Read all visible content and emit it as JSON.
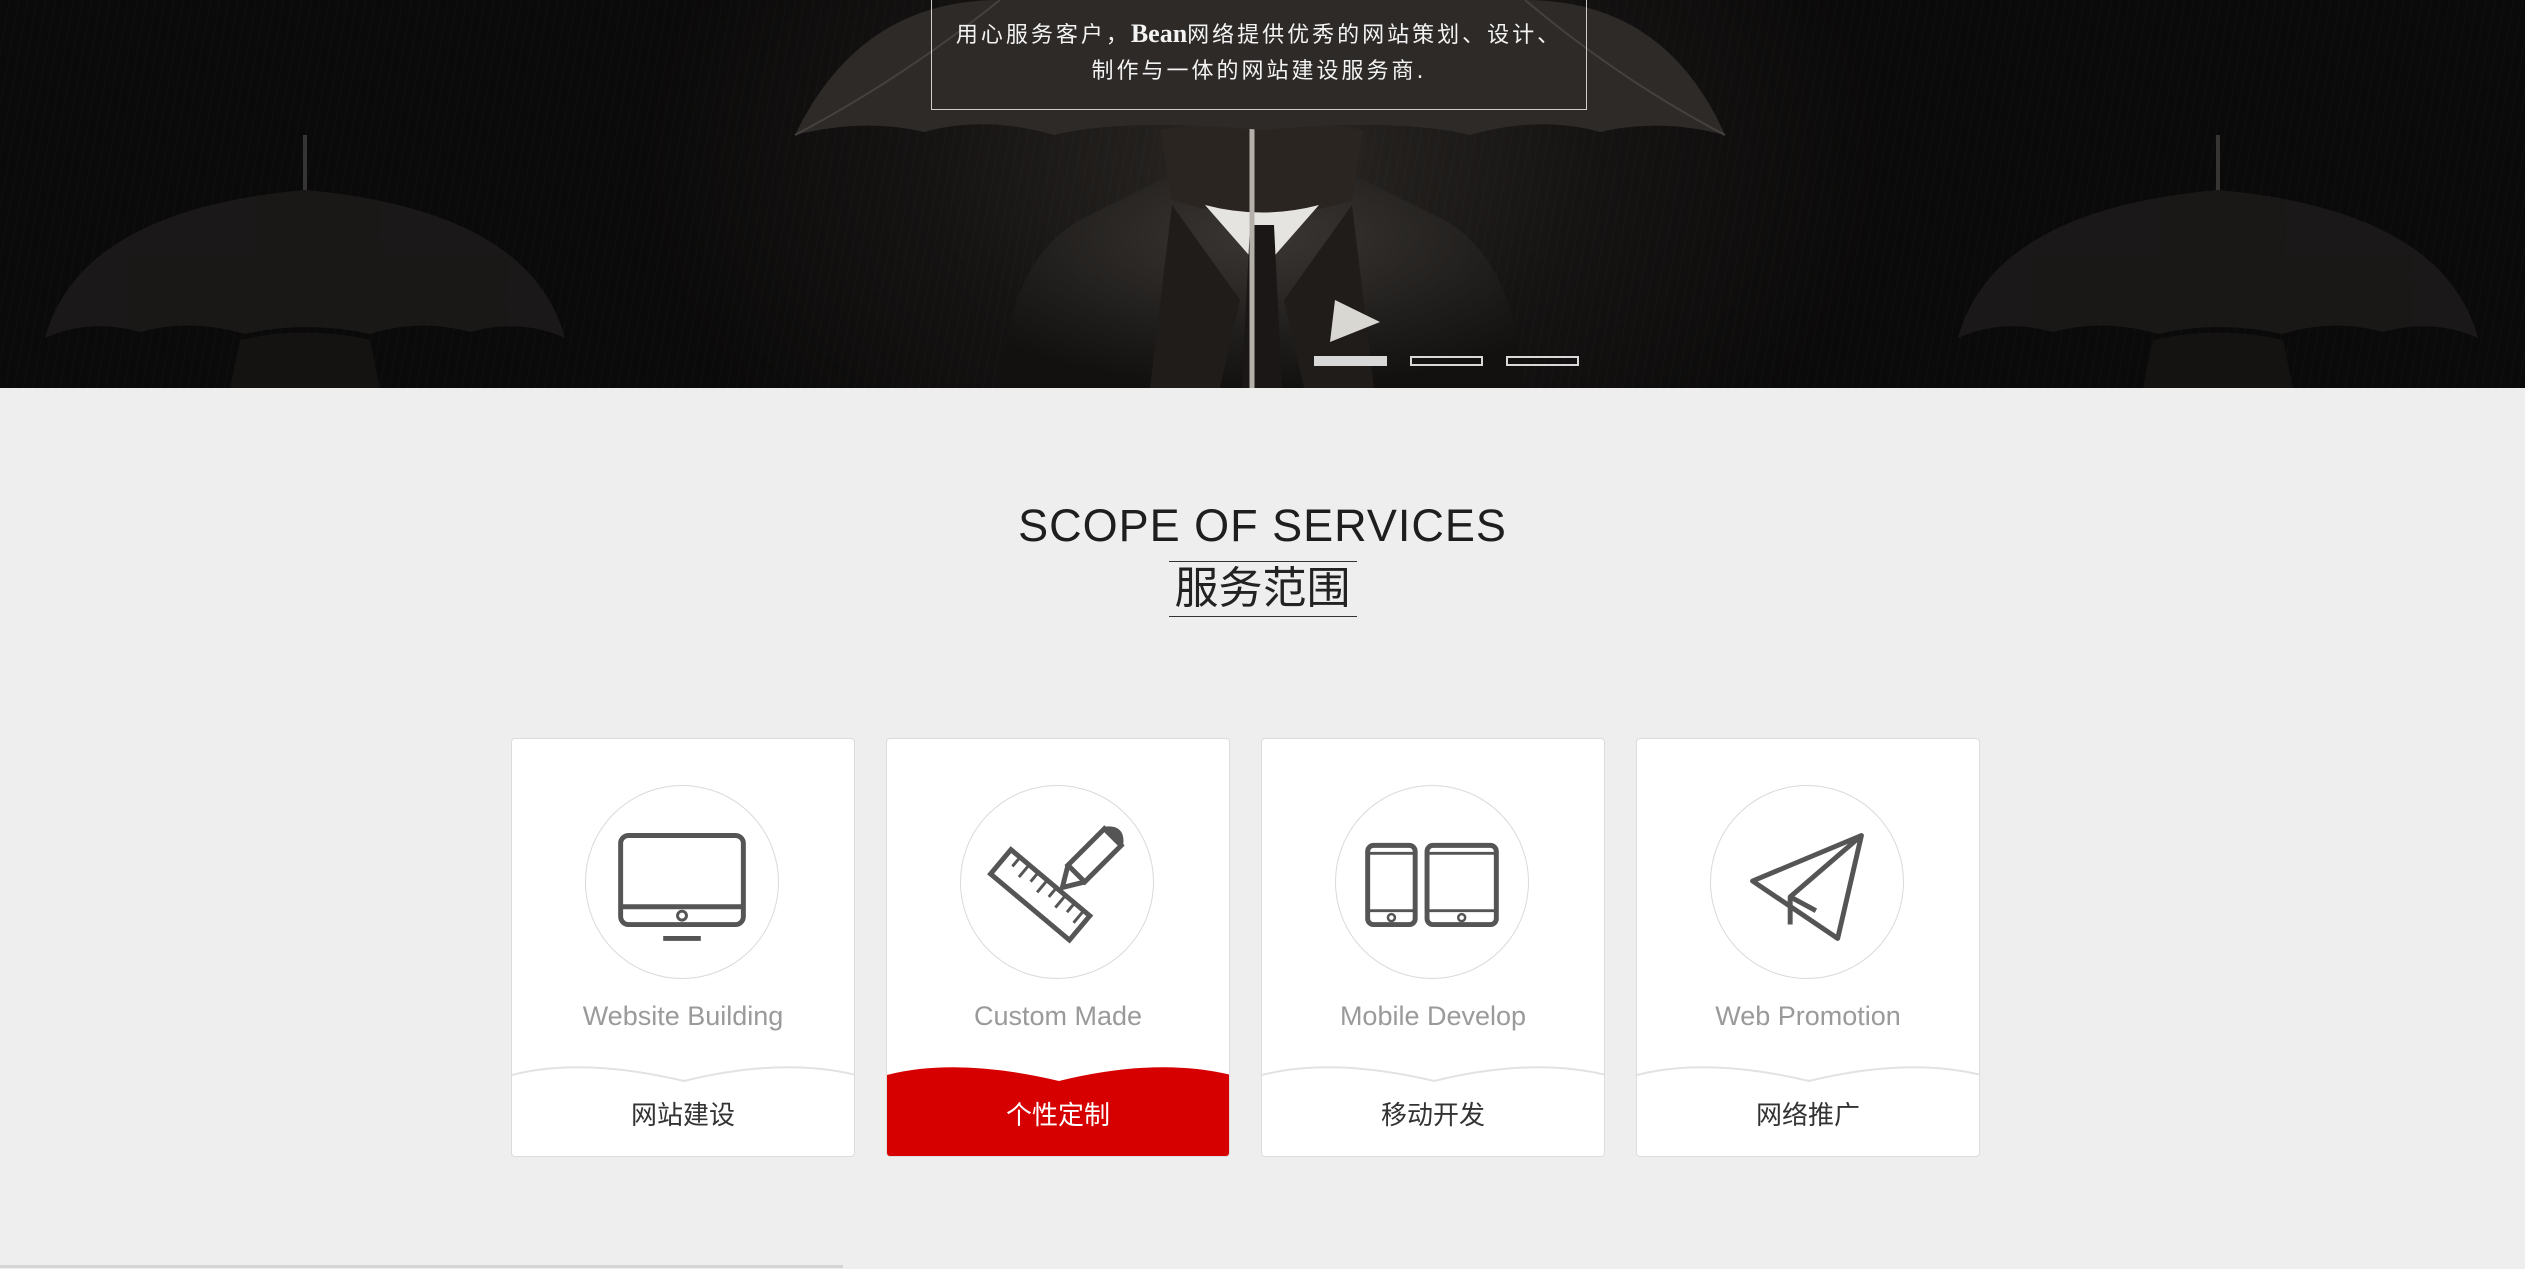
{
  "hero": {
    "caption_line1_pre": "用心服务客户，",
    "caption_brand": "Bean",
    "caption_line1_post": "网络提供优秀的网站策划、设计、",
    "caption_line2": "制作与一体的网站建设服务商.",
    "slides_count": 3,
    "active_slide": 1
  },
  "section": {
    "title": "SCOPE OF SERVICES",
    "subtitle": "服务范围"
  },
  "services": [
    {
      "en": "Website Building",
      "cn": "网站建设",
      "icon": "monitor-icon",
      "active": false
    },
    {
      "en": "Custom Made",
      "cn": "个性定制",
      "icon": "ruler-pencil-icon",
      "active": true
    },
    {
      "en": "Mobile Develop",
      "cn": "移动开发",
      "icon": "tablet-phone-icon",
      "active": false
    },
    {
      "en": "Web Promotion",
      "cn": "网络推广",
      "icon": "paper-plane-icon",
      "active": false
    }
  ],
  "colors": {
    "accent": "#d60000",
    "background": "#eeeeee",
    "icon": "#555555"
  }
}
